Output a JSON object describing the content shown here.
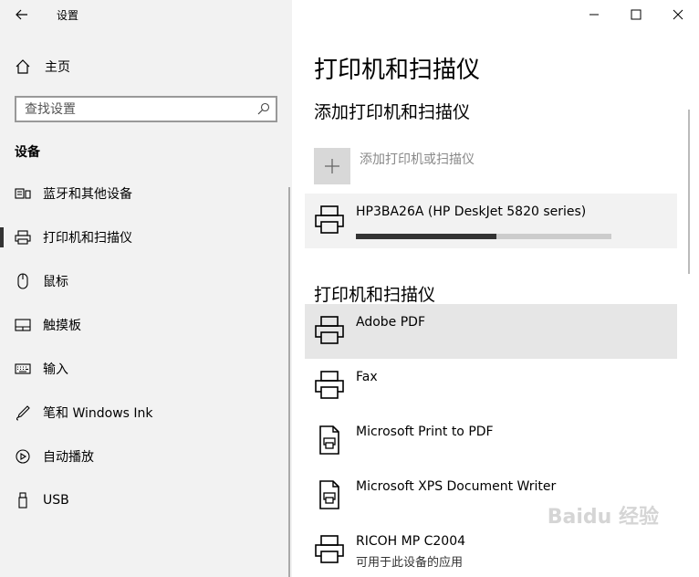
{
  "window": {
    "app_title": "设置"
  },
  "sidebar": {
    "home_label": "主页",
    "search_placeholder": "查找设置",
    "section_title": "设备",
    "items": [
      {
        "label": "蓝牙和其他设备",
        "icon": "bluetooth-devices-icon"
      },
      {
        "label": "打印机和扫描仪",
        "icon": "printer-icon",
        "selected": true
      },
      {
        "label": "鼠标",
        "icon": "mouse-icon"
      },
      {
        "label": "触摸板",
        "icon": "touchpad-icon"
      },
      {
        "label": "输入",
        "icon": "keyboard-icon"
      },
      {
        "label": "笔和 Windows Ink",
        "icon": "pen-icon"
      },
      {
        "label": "自动播放",
        "icon": "autoplay-icon"
      },
      {
        "label": "USB",
        "icon": "usb-icon"
      }
    ]
  },
  "main": {
    "title": "打印机和扫描仪",
    "add_section_title": "添加打印机和扫描仪",
    "add_label": "添加打印机或扫描仪",
    "pending_device": {
      "name": "HP3BA26A (HP DeskJet 5820 series)",
      "progress": 0.55
    },
    "list_section_title": "打印机和扫描仪",
    "devices": [
      {
        "name": "Adobe PDF",
        "icon": "printer-icon",
        "selected": true
      },
      {
        "name": "Fax",
        "icon": "printer-icon"
      },
      {
        "name": "Microsoft Print to PDF",
        "icon": "document-printer-icon"
      },
      {
        "name": "Microsoft XPS Document Writer",
        "icon": "document-printer-icon"
      },
      {
        "name": "RICOH MP C2004",
        "status": "可用于此设备的应用",
        "icon": "printer-icon"
      }
    ]
  },
  "watermark": "Baidu 经验"
}
